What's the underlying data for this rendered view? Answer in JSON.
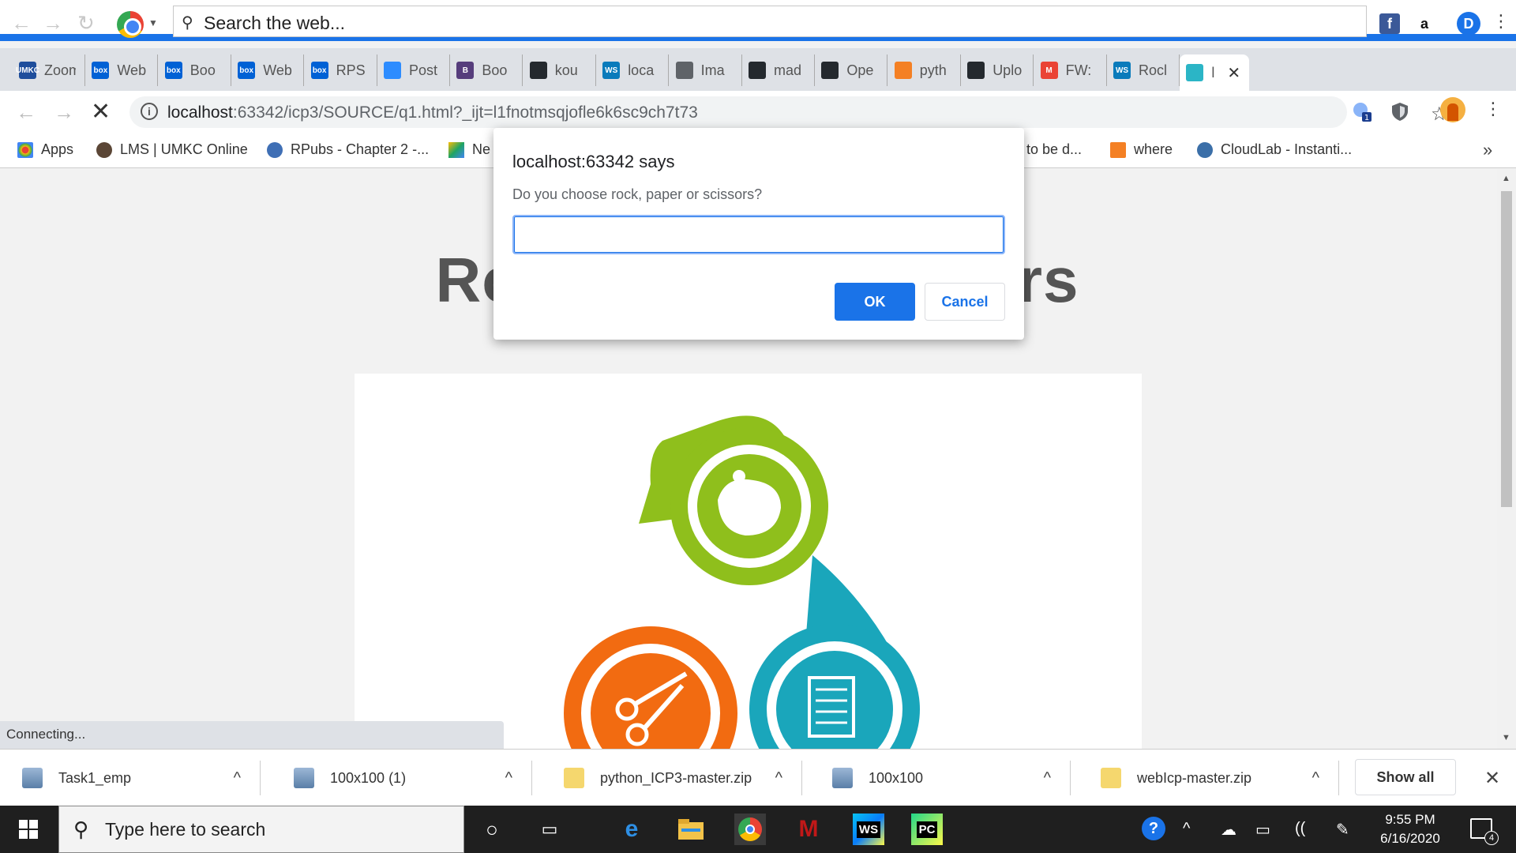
{
  "top_toolbar": {
    "search_placeholder": "Search the web...",
    "extensions": [
      "facebook-icon",
      "amazon-icon",
      "profile-d-icon"
    ],
    "amazon_label": "a",
    "profile_label": "D"
  },
  "tabs": [
    {
      "label": "Zoom",
      "icon": "umkc-icon",
      "color": "#1f4e9c",
      "badge": "UMKC"
    },
    {
      "label": "Web",
      "icon": "box-icon",
      "color": "#0061d5",
      "badge": "box"
    },
    {
      "label": "Boo",
      "icon": "box-icon",
      "color": "#0061d5",
      "badge": "box"
    },
    {
      "label": "Web",
      "icon": "box-icon",
      "color": "#0061d5",
      "badge": "box"
    },
    {
      "label": "RPS",
      "icon": "box-icon",
      "color": "#0061d5",
      "badge": "box"
    },
    {
      "label": "Post",
      "icon": "zoom-icon",
      "color": "#2d8cff",
      "badge": ""
    },
    {
      "label": "Boo",
      "icon": "bootstrap-icon",
      "color": "#563d7c",
      "badge": "B"
    },
    {
      "label": "kou",
      "icon": "github-icon",
      "color": "#24292e",
      "badge": ""
    },
    {
      "label": "loca",
      "icon": "webstorm-icon",
      "color": "#0a7bbb",
      "badge": "WS"
    },
    {
      "label": "Ima",
      "icon": "globe-icon",
      "color": "#5f6368",
      "badge": ""
    },
    {
      "label": "mad",
      "icon": "github-icon",
      "color": "#24292e",
      "badge": ""
    },
    {
      "label": "Ope",
      "icon": "github-icon",
      "color": "#24292e",
      "badge": ""
    },
    {
      "label": "pyth",
      "icon": "stackoverflow-icon",
      "color": "#f48024",
      "badge": ""
    },
    {
      "label": "Uplo",
      "icon": "github-icon",
      "color": "#24292e",
      "badge": ""
    },
    {
      "label": "FW:",
      "icon": "gmail-icon",
      "color": "#ea4335",
      "badge": "M"
    },
    {
      "label": "Rocl",
      "icon": "webstorm-icon",
      "color": "#0a7bbb",
      "badge": "WS"
    },
    {
      "label": "l",
      "icon": "rps-icon",
      "color": "#2bb5c6",
      "badge": ""
    }
  ],
  "address": {
    "host": "localhost",
    "path": ":63342/icp3/SOURCE/q1.html?_ijt=l1fnotmsqjofle6k6sc9ch7t73"
  },
  "bookmarks": [
    {
      "label": "Apps",
      "color": "#e94235"
    },
    {
      "label": "LMS | UMKC Online",
      "color": "#5b4636"
    },
    {
      "label": "RPubs - Chapter 2 -...",
      "color": "#3f6fb5"
    },
    {
      "label": "Ne",
      "color": "#1fa463"
    },
    {
      "label": "to be d...",
      "color": "#ffffff"
    },
    {
      "label": "where",
      "color": "#f48024"
    },
    {
      "label": "CloudLab - Instanti...",
      "color": "#3b6fa8"
    }
  ],
  "page": {
    "title": "Rock Paper Scissors"
  },
  "dialog": {
    "title": "localhost:63342 says",
    "message": "Do you choose rock, paper or scissors?",
    "input_value": "",
    "ok_label": "OK",
    "cancel_label": "Cancel"
  },
  "status": "Connecting...",
  "downloads": [
    {
      "name": "Task1_emp"
    },
    {
      "name": "100x100 (1)"
    },
    {
      "name": "python_ICP3-master.zip"
    },
    {
      "name": "100x100"
    },
    {
      "name": "webIcp-master.zip"
    }
  ],
  "downloads_show_all": "Show all",
  "taskbar": {
    "search_placeholder": "Type here to search",
    "time": "9:55 PM",
    "date": "6/16/2020",
    "notification_count": "4",
    "apps": [
      "cortana-icon",
      "task-view-icon",
      "edge-icon",
      "file-explorer-icon",
      "chrome-icon",
      "mcafee-icon",
      "webstorm-icon",
      "pycharm-icon"
    ]
  }
}
